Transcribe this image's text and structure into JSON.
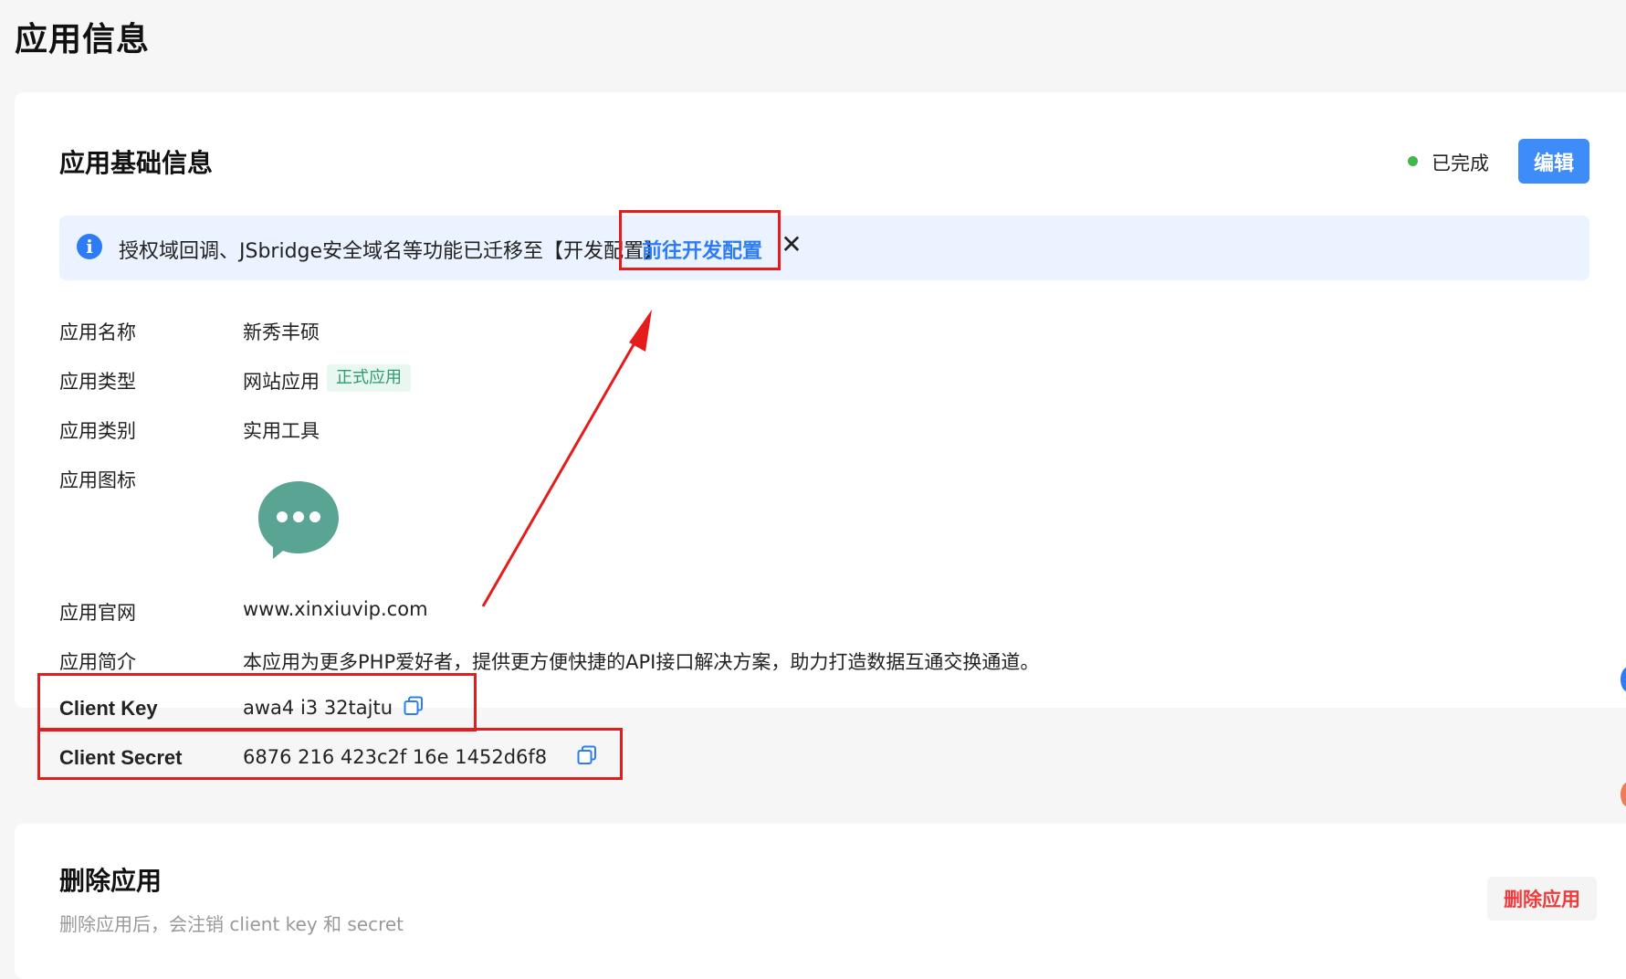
{
  "page": {
    "title": "应用信息"
  },
  "basic": {
    "section_title": "应用基础信息",
    "status": "已完成",
    "edit_label": "编辑",
    "notice": {
      "text": "授权域回调、JSbridge安全域名等功能已迁移至【开发配置】",
      "link": "前往开发配置",
      "close": "✕"
    },
    "fields": {
      "app_name": {
        "label": "应用名称",
        "value": "新秀丰硕"
      },
      "app_type": {
        "label": "应用类型",
        "value": "网站应用",
        "tag": "正式应用"
      },
      "app_category": {
        "label": "应用类别",
        "value": "实用工具"
      },
      "app_icon": {
        "label": "应用图标"
      },
      "website": {
        "label": "应用官网",
        "value": "www.xinxiuvip.com"
      },
      "intro": {
        "label": "应用简介",
        "value": "本应用为更多PHP爱好者，提供更方便快捷的API接口解决方案，助力打造数据互通交换通道。"
      },
      "client_key": {
        "label": "Client Key",
        "value": "awa4   i3   32tajtu"
      },
      "client_secret": {
        "label": "Client Secret",
        "value": "6876   216   423c2f    16e    1452d6f8"
      }
    }
  },
  "delete": {
    "section_title": "删除应用",
    "desc": "删除应用后，会注销 client key 和 secret",
    "button_label": "删除应用"
  },
  "colors": {
    "primary": "#3e8cf7",
    "notice_bg": "#eaf3ff",
    "success_dot": "#41b84a",
    "tag_bg": "#e8f7f0",
    "tag_text": "#2f9a73",
    "danger": "#ef3b3b",
    "annotation_red": "#e61b1b",
    "app_icon": "#5aa493"
  },
  "icons": {
    "notice": "info-circle-icon",
    "close": "close-icon",
    "app": "chat-bubble-icon",
    "copy": "copy-icon"
  }
}
